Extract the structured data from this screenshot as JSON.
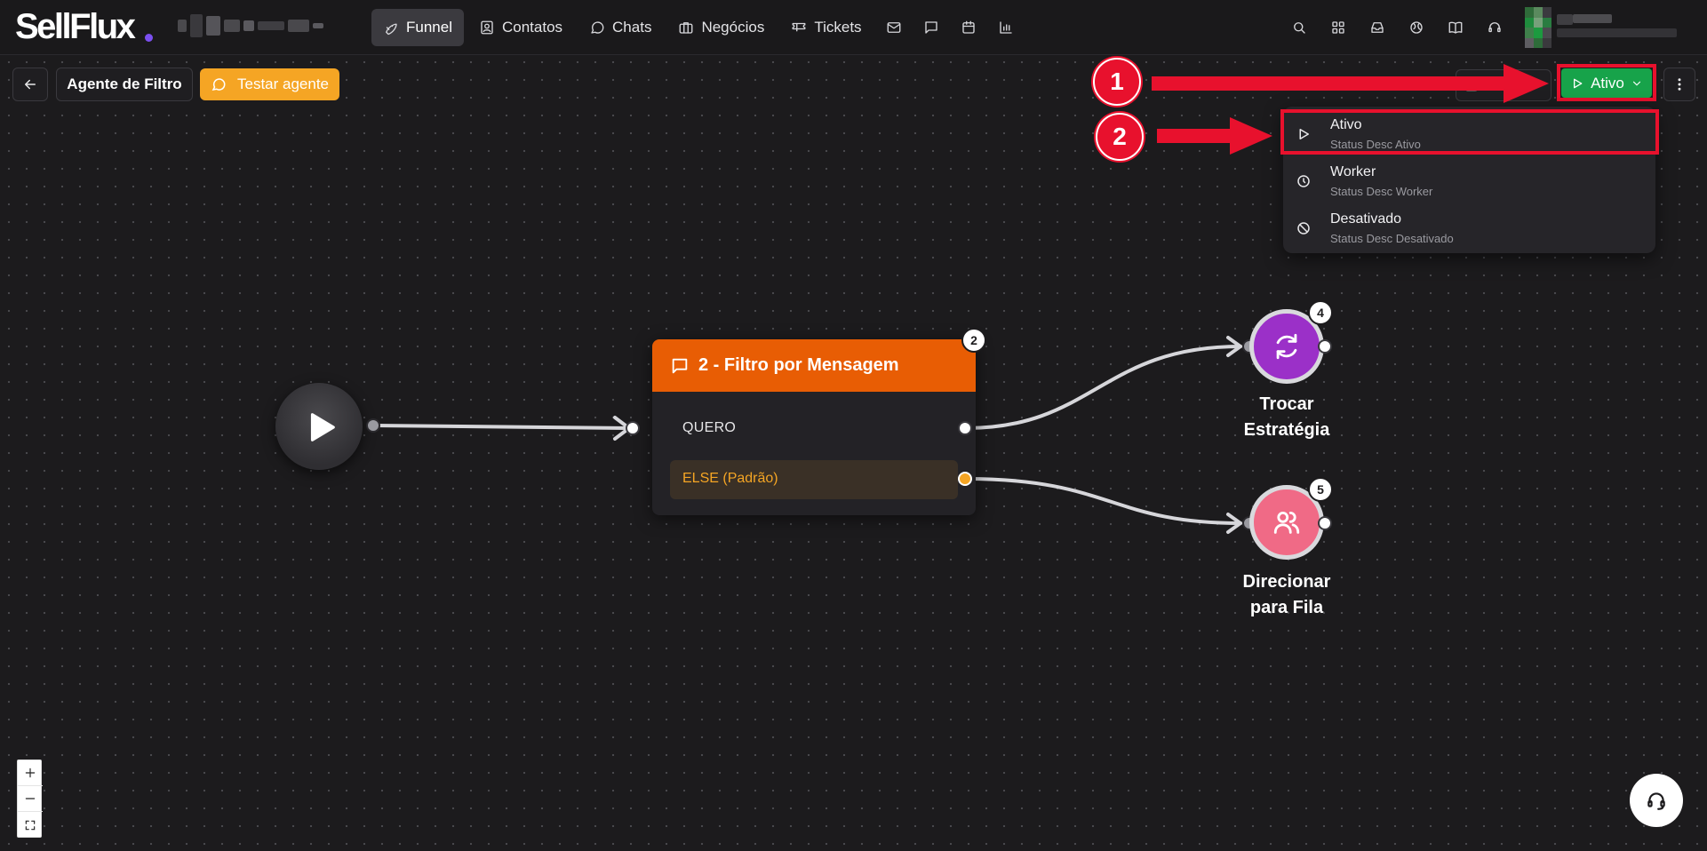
{
  "app": {
    "logo_text": "SellFlux"
  },
  "nav": {
    "items": [
      {
        "label": "Funnel",
        "icon": "rocket-icon",
        "active": true
      },
      {
        "label": "Contatos",
        "icon": "contacts-icon"
      },
      {
        "label": "Chats",
        "icon": "chat-icon"
      },
      {
        "label": "Negócios",
        "icon": "briefcase-icon"
      },
      {
        "label": "Tickets",
        "icon": "ticket-icon"
      }
    ],
    "extra_icons": [
      "mail-icon",
      "message-square-icon",
      "calendar-icon",
      "bar-chart-icon"
    ]
  },
  "header_right_icons": [
    "search-icon",
    "apps-grid-icon",
    "inbox-icon",
    "globe-icon",
    "book-icon",
    "headset-icon"
  ],
  "toolbar": {
    "back_icon": "arrow-left-icon",
    "agent_name": "Agente de Filtro",
    "test_button": "Testar agente",
    "status_button": "Ativo"
  },
  "status_menu": {
    "options": [
      {
        "title": "Ativo",
        "desc": "Status Desc Ativo",
        "icon": "play-icon"
      },
      {
        "title": "Worker",
        "desc": "Status Desc Worker",
        "icon": "clock-icon"
      },
      {
        "title": "Desativado",
        "desc": "Status Desc Desativado",
        "icon": "ban-icon"
      }
    ]
  },
  "annotations": {
    "step1": "1",
    "step2": "2"
  },
  "flow": {
    "filter_node": {
      "badge": "2",
      "title": "2 - Filtro por Mensagem",
      "rows": [
        "QUERO",
        "ELSE (Padrão)"
      ]
    },
    "strategy_node": {
      "badge": "4",
      "label_line1": "Trocar",
      "label_line2": "Estratégia",
      "color": "#9b30c8"
    },
    "queue_node": {
      "badge": "5",
      "label_line1": "Direcionar",
      "label_line2": "para Fila",
      "color": "#f06a86"
    }
  },
  "colors": {
    "accent_orange": "#e85d04",
    "test_button": "#f5a524",
    "status_green": "#17a34a",
    "annotation_red": "#e8112d"
  }
}
